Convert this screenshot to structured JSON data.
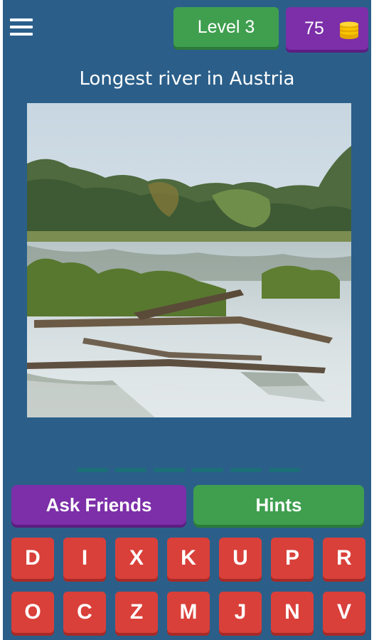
{
  "header": {
    "menu_icon": "hamburger-menu-icon",
    "level_label": "Level 3",
    "coins": "75",
    "coin_icon": "coin-stack-icon"
  },
  "question": "Longest river in Austria",
  "answer_slots": 6,
  "actions": {
    "ask_friends": "Ask Friends",
    "hints": "Hints"
  },
  "keyboard": {
    "row1": [
      "D",
      "I",
      "X",
      "K",
      "U",
      "P",
      "R"
    ],
    "row2": [
      "O",
      "C",
      "Z",
      "M",
      "J",
      "N",
      "V"
    ]
  },
  "colors": {
    "background": "#2b5f8a",
    "green": "#3f9f4f",
    "purple": "#7c2fa8",
    "key_red": "#d9403a",
    "slot": "#1c6f78"
  }
}
